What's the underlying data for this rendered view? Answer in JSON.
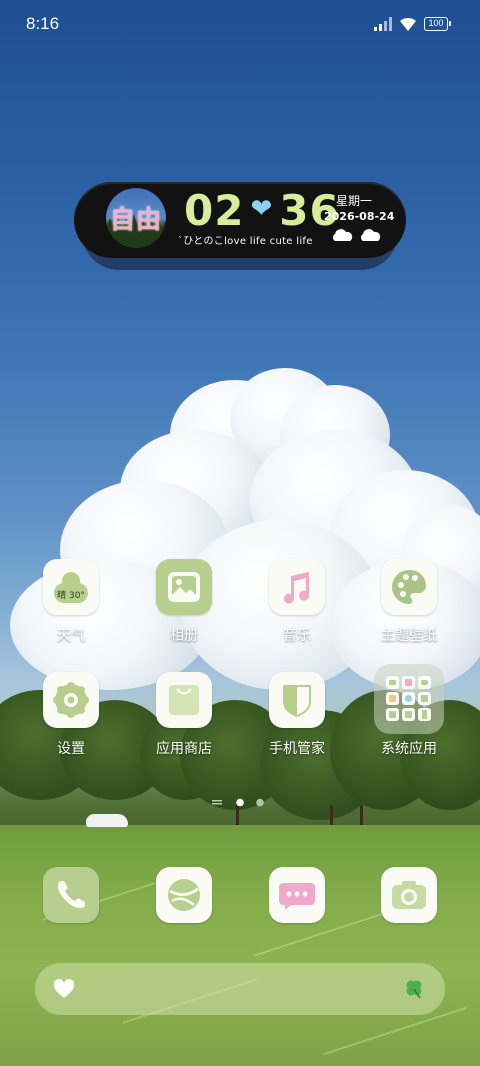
{
  "status_bar": {
    "time": "8:16",
    "battery": "100"
  },
  "widget": {
    "avatar_text": "自由",
    "hours": "02",
    "minutes": "36",
    "weekday": "星期一",
    "date": "2026-08-24",
    "tagline": "`ひとのこlove life cute life",
    "weather_icons": [
      "cloud-icon",
      "cloud-icon"
    ]
  },
  "weather_tile": {
    "condition": "晴",
    "temp": "30°"
  },
  "apps": {
    "row1": [
      {
        "label": "天气",
        "icon": "weather-icon"
      },
      {
        "label": "相册",
        "icon": "gallery-icon"
      },
      {
        "label": "音乐",
        "icon": "music-icon"
      },
      {
        "label": "主题壁纸",
        "icon": "palette-icon"
      }
    ],
    "row2": [
      {
        "label": "设置",
        "icon": "gear-icon"
      },
      {
        "label": "应用商店",
        "icon": "shopping-bag-icon"
      },
      {
        "label": "手机管家",
        "icon": "shield-icon"
      },
      {
        "label": "系统应用",
        "icon": "folder-icon"
      }
    ],
    "dock": [
      {
        "icon": "phone-icon"
      },
      {
        "icon": "browser-icon"
      },
      {
        "icon": "messages-icon"
      },
      {
        "icon": "camera-icon"
      }
    ]
  },
  "page_indicator": {
    "pages": 2,
    "current": 1
  },
  "bottom_bar": {
    "left_icon": "heart-icon",
    "right_icon": "clover-icon"
  },
  "colors": {
    "accent_green": "#b7cf8e",
    "clock_green": "#d8ec9b",
    "colon_blue": "#8fd0ef",
    "pink": "#f0a9c8",
    "tile_bg": "#fbfbf5"
  }
}
